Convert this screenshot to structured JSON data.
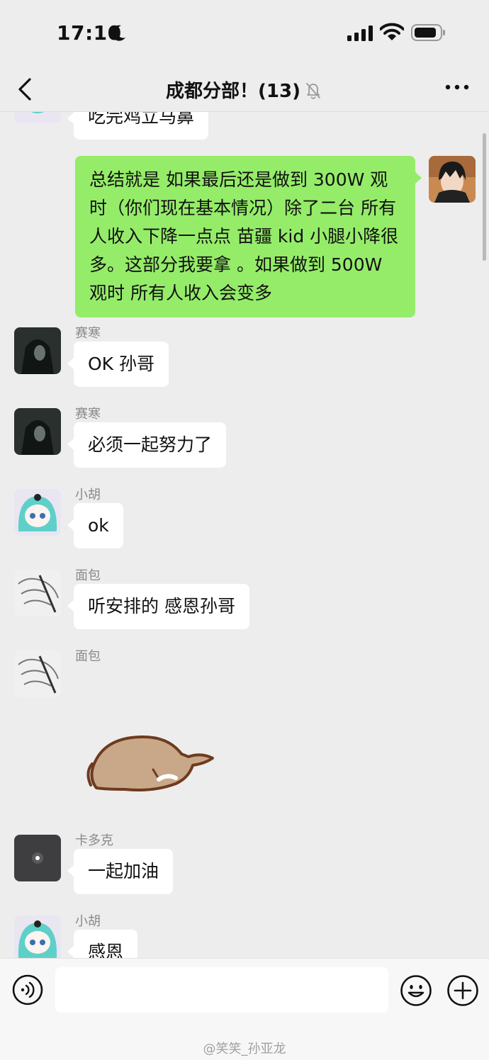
{
  "status_bar": {
    "time": "17:10"
  },
  "header": {
    "title": "成都分部！(13)"
  },
  "messages": {
    "partial": "吃完鸡立马鼻",
    "self": "总结就是 如果最后还是做到 300W 观时（你们现在基本情况）除了二台 所有人收入下降一点点 苗疆 kid 小腿小降很多。这部分我要拿 。如果做到 500W 观时 所有人收入会变多",
    "m1": {
      "sender": "赛寒",
      "text": "OK 孙哥"
    },
    "m2": {
      "sender": "赛寒",
      "text": "必须一起努力了"
    },
    "m3": {
      "sender": "小胡",
      "text": "ok"
    },
    "m4": {
      "sender": "面包",
      "text": "听安排的 感恩孙哥"
    },
    "m5": {
      "sender": "面包"
    },
    "m6": {
      "sender": "卡多克",
      "text": "一起加油"
    },
    "m7": {
      "sender": "小胡",
      "text": "感恩"
    }
  },
  "input": {
    "placeholder": ""
  },
  "watermark": "@笑笑_孙亚龙",
  "colors": {
    "self_bubble": "#95ec69",
    "other_bubble": "#ffffff",
    "background": "#ededed"
  }
}
